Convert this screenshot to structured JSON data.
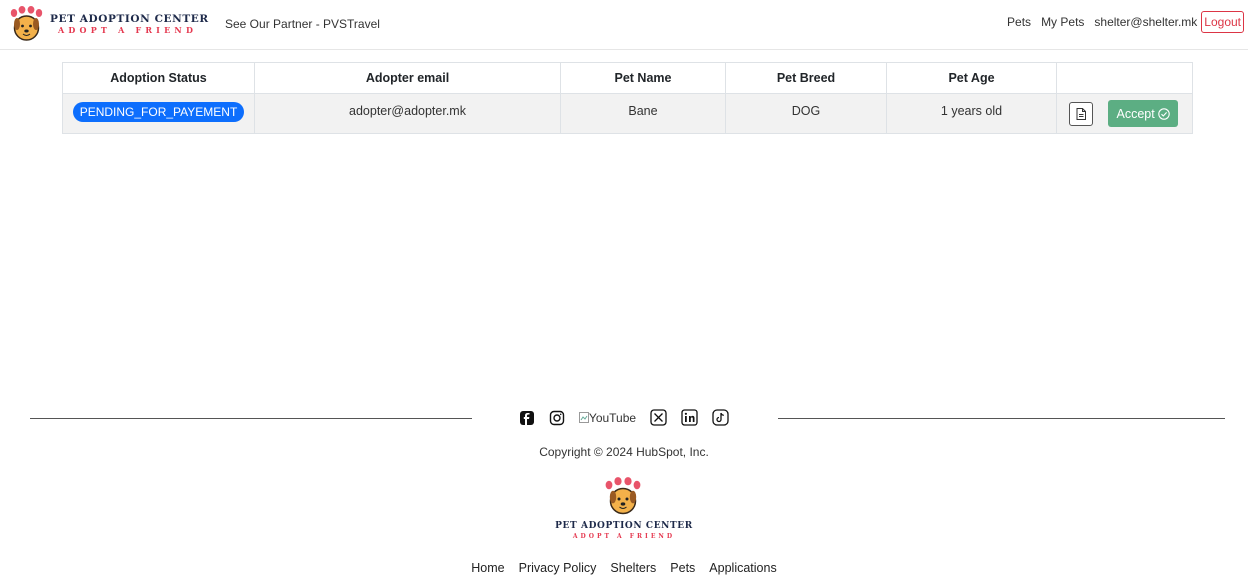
{
  "brand": {
    "title": "PET ADOPTION CENTER",
    "subtitle": "ADOPT A FRIEND"
  },
  "nav": {
    "partner_link": "See Our Partner - PVSTravel",
    "pets": "Pets",
    "my_pets": "My Pets",
    "user_email": "shelter@shelter.mk",
    "logout": "Logout"
  },
  "table": {
    "headers": [
      "Adoption Status",
      "Adopter email",
      "Pet Name",
      "Pet Breed",
      "Pet Age",
      ""
    ],
    "rows": [
      {
        "status": "PENDING_FOR_PAYEMENT",
        "email": "adopter@adopter.mk",
        "pet_name": "Bane",
        "breed": "DOG",
        "age": "1 years old",
        "accept_label": "Accept"
      }
    ]
  },
  "footer": {
    "social": [
      "facebook-icon",
      "instagram-icon",
      "youtube-image",
      "x-icon",
      "linkedin-icon",
      "tiktok-icon"
    ],
    "youtube_alt": "YouTube",
    "copyright": "Copyright © 2024 HubSpot, Inc.",
    "logo_title": "PET ADOPTION CENTER",
    "logo_subtitle": "ADOPT A FRIEND",
    "links": [
      "Home",
      "Privacy Policy",
      "Shelters",
      "Pets",
      "Applications"
    ]
  },
  "colors": {
    "accent_blue": "#0d6efd",
    "accept_green": "#5cae83",
    "logout_red": "#dc3545",
    "brand_navy": "#1e2a4a",
    "brand_pink": "#e53950"
  }
}
